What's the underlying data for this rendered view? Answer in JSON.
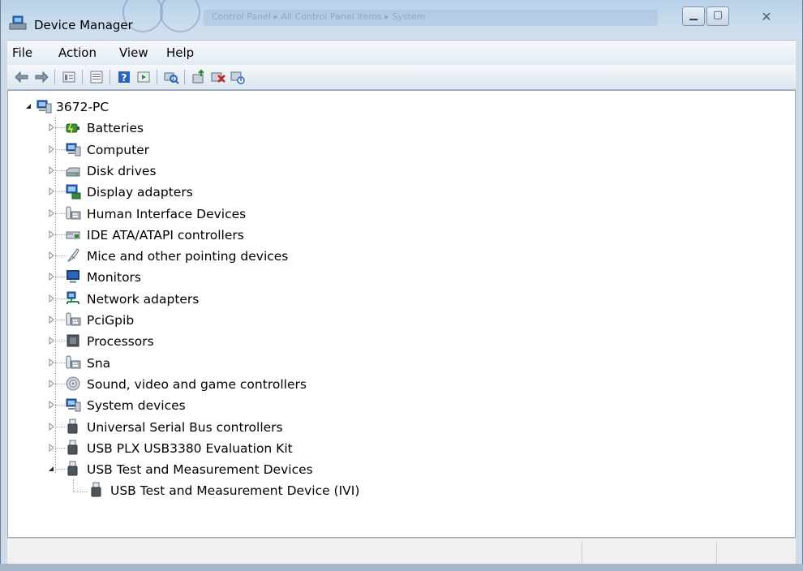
{
  "window": {
    "title": "Device Manager"
  },
  "menu": [
    "File",
    "Action",
    "View",
    "Help"
  ],
  "toolbar": [
    "back-icon",
    "forward-icon",
    "properties-icon",
    "update-view-icon",
    "help-icon",
    "show-hidden-icon",
    "scan-hardware-icon",
    "update-driver-icon",
    "uninstall-icon",
    "disable-icon"
  ],
  "tree": {
    "root": {
      "label": "3672-PC",
      "expanded": true,
      "icon": "computer-icon"
    },
    "categories": [
      {
        "label": "Batteries",
        "icon": "battery-icon",
        "expanded": false
      },
      {
        "label": "Computer",
        "icon": "computer-icon",
        "expanded": false
      },
      {
        "label": "Disk drives",
        "icon": "disk-drive-icon",
        "expanded": false
      },
      {
        "label": "Display adapters",
        "icon": "display-adapter-icon",
        "expanded": false
      },
      {
        "label": "Human Interface Devices",
        "icon": "hid-icon",
        "expanded": false
      },
      {
        "label": "IDE ATA/ATAPI controllers",
        "icon": "ide-controller-icon",
        "expanded": false
      },
      {
        "label": "Mice and other pointing devices",
        "icon": "mouse-icon",
        "expanded": false
      },
      {
        "label": "Monitors",
        "icon": "monitor-icon",
        "expanded": false
      },
      {
        "label": "Network adapters",
        "icon": "network-adapter-icon",
        "expanded": false
      },
      {
        "label": "PciGpib",
        "icon": "hid-icon",
        "expanded": false
      },
      {
        "label": "Processors",
        "icon": "processor-icon",
        "expanded": false
      },
      {
        "label": "Sna",
        "icon": "hid-icon",
        "expanded": false
      },
      {
        "label": "Sound, video and game controllers",
        "icon": "speaker-icon",
        "expanded": false
      },
      {
        "label": "System devices",
        "icon": "computer-icon",
        "expanded": false
      },
      {
        "label": "Universal Serial Bus controllers",
        "icon": "usb-icon",
        "expanded": false
      },
      {
        "label": "USB PLX USB3380 Evaluation Kit",
        "icon": "usb-icon",
        "expanded": false
      },
      {
        "label": "USB Test and Measurement Devices",
        "icon": "usb-icon",
        "expanded": true,
        "children": [
          {
            "label": "USB Test and Measurement Device (IVI)",
            "icon": "usb-icon"
          }
        ]
      }
    ]
  },
  "background_breadcrumb": "Control Panel  ▸  All Control Panel Items  ▸  System"
}
